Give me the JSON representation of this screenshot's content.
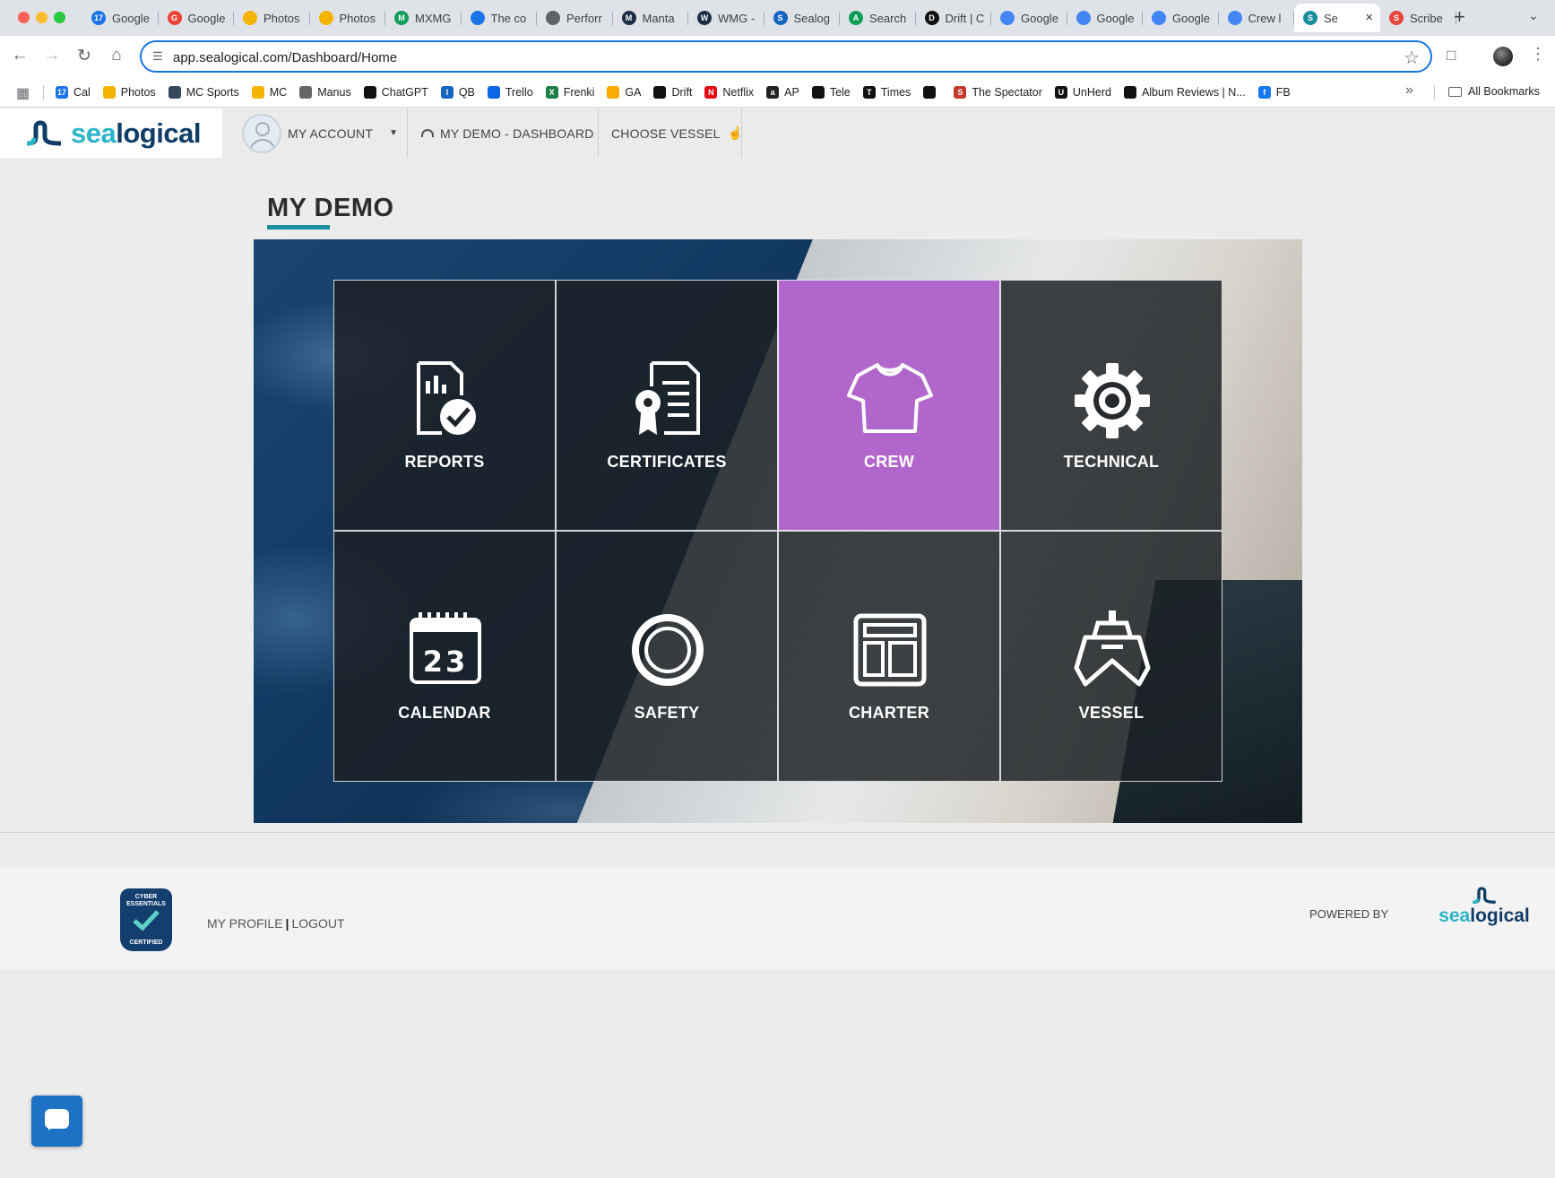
{
  "browser": {
    "tabs": [
      {
        "label": "Google",
        "color": "#1a73e8",
        "glyph": "17"
      },
      {
        "label": "Google",
        "color": "#ea4335",
        "glyph": "G"
      },
      {
        "label": "Photos",
        "color": "#f4b400",
        "glyph": ""
      },
      {
        "label": "Photos",
        "color": "#f4b400",
        "glyph": ""
      },
      {
        "label": "MXMG",
        "color": "#0f9d58",
        "glyph": "M"
      },
      {
        "label": "The co",
        "color": "#1a73e8",
        "glyph": ""
      },
      {
        "label": "Perforr",
        "color": "#5f6368",
        "glyph": ""
      },
      {
        "label": "Manta",
        "color": "#1d2d44",
        "glyph": "M"
      },
      {
        "label": "WMG -",
        "color": "#1d2d44",
        "glyph": "W"
      },
      {
        "label": "Sealog",
        "color": "#1565c0",
        "glyph": "S"
      },
      {
        "label": "Search",
        "color": "#0f9d58",
        "glyph": "A"
      },
      {
        "label": "Drift | C",
        "color": "#111111",
        "glyph": "D"
      },
      {
        "label": "Google",
        "color": "#4285f4",
        "glyph": ""
      },
      {
        "label": "Google",
        "color": "#4285f4",
        "glyph": ""
      },
      {
        "label": "Google",
        "color": "#4285f4",
        "glyph": ""
      },
      {
        "label": "Crew l",
        "color": "#4285f4",
        "glyph": ""
      },
      {
        "label": "Se",
        "color": "#1a8f9c",
        "glyph": "S",
        "active": true
      },
      {
        "label": "Scribe",
        "color": "#e8453c",
        "glyph": "S"
      }
    ],
    "url": "app.sealogical.com/Dashboard/Home",
    "bookmarks": [
      {
        "label": "Cal",
        "color": "#1a73e8",
        "glyph": "17"
      },
      {
        "label": "Photos",
        "color": "#f4b400",
        "glyph": ""
      },
      {
        "label": "MC Sports",
        "color": "#34495e",
        "glyph": ""
      },
      {
        "label": "MC",
        "color": "#f4b400",
        "glyph": ""
      },
      {
        "label": "Manus",
        "color": "#666666",
        "glyph": ""
      },
      {
        "label": "ChatGPT",
        "color": "#111111",
        "glyph": ""
      },
      {
        "label": "QB",
        "color": "#1565c0",
        "glyph": "I"
      },
      {
        "label": "Trello",
        "color": "#0c66e4",
        "glyph": ""
      },
      {
        "label": "Frenki",
        "color": "#1e7e45",
        "glyph": "X"
      },
      {
        "label": "GA",
        "color": "#f9ab00",
        "glyph": ""
      },
      {
        "label": "Drift",
        "color": "#111111",
        "glyph": ""
      },
      {
        "label": "Netflix",
        "color": "#e50914",
        "glyph": "N"
      },
      {
        "label": "AP",
        "color": "#222222",
        "glyph": "a"
      },
      {
        "label": "Tele",
        "color": "#111111",
        "glyph": ""
      },
      {
        "label": "Times",
        "color": "#111111",
        "glyph": "T"
      },
      {
        "label": "",
        "color": "#111111",
        "glyph": ""
      },
      {
        "label": "The Spectator",
        "color": "#c0392b",
        "glyph": "S"
      },
      {
        "label": "UnHerd",
        "color": "#111111",
        "glyph": "U"
      },
      {
        "label": "Album Reviews | N...",
        "color": "#111111",
        "glyph": ""
      },
      {
        "label": "FB",
        "color": "#1877f2",
        "glyph": "f"
      }
    ],
    "all_bookmarks_label": "All Bookmarks"
  },
  "header": {
    "brand_sea": "sea",
    "brand_logical": "logical",
    "account_label": "MY ACCOUNT",
    "dashboard_label": "MY DEMO - DASHBOARD",
    "choose_vessel_label": "CHOOSE VESSEL"
  },
  "page": {
    "title": "MY DEMO"
  },
  "tiles": [
    {
      "label": "REPORTS",
      "icon": "report-check-icon"
    },
    {
      "label": "CERTIFICATES",
      "icon": "certificate-icon"
    },
    {
      "label": "CREW",
      "icon": "tshirt-icon",
      "highlight": true
    },
    {
      "label": "TECHNICAL",
      "icon": "gear-icon"
    },
    {
      "label": "CALENDAR",
      "icon": "calendar-icon",
      "day": "23"
    },
    {
      "label": "SAFETY",
      "icon": "lifebuoy-icon"
    },
    {
      "label": "CHARTER",
      "icon": "layout-icon"
    },
    {
      "label": "VESSEL",
      "icon": "ship-icon"
    }
  ],
  "colors": {
    "accent": "#1a8f9c",
    "crew_highlight": "#b166cc",
    "brand_light": "#2bb5c8",
    "brand_dark": "#0f3d67"
  },
  "footer": {
    "badge_top": "CYBER ESSENTIALS",
    "badge_bottom": "CERTIFIED",
    "profile_link": "MY PROFILE",
    "separator": "|",
    "logout_link": "LOGOUT",
    "powered_by": "POWERED BY",
    "brand_sea": "sea",
    "brand_logical": "logical"
  }
}
